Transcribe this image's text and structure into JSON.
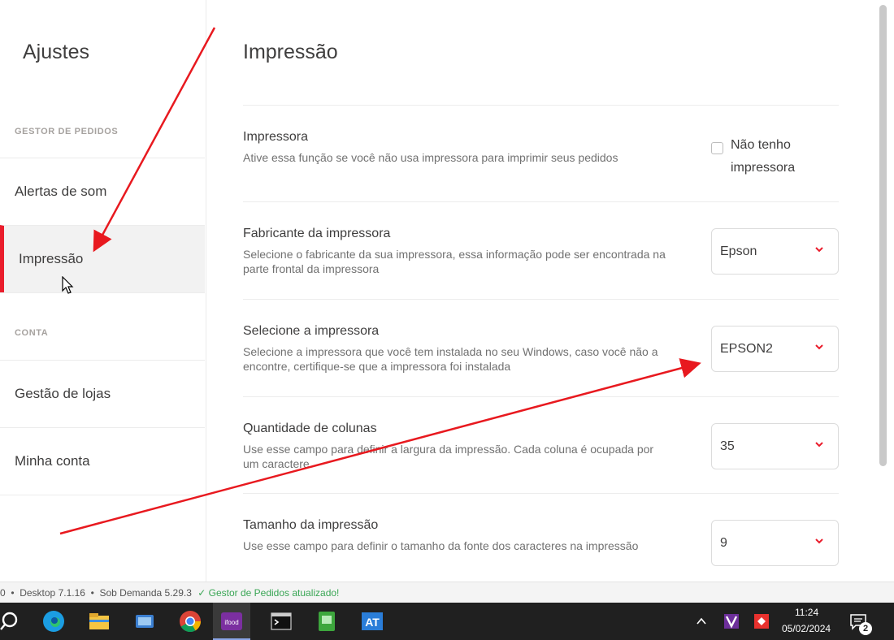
{
  "sidebar": {
    "title": "Ajustes",
    "sections": [
      {
        "label": "GESTOR DE PEDIDOS"
      },
      {
        "label": "CONTA"
      }
    ],
    "items": [
      {
        "label": "Alertas de som"
      },
      {
        "label": "Impressão"
      },
      {
        "label": "Gestão de lojas"
      },
      {
        "label": "Minha conta"
      }
    ]
  },
  "main": {
    "title": "Impressão",
    "rows": [
      {
        "title": "Impressora",
        "desc": "Ative essa função se você não usa impressora para imprimir seus pedidos",
        "checkbox_label": "Não tenho impressora",
        "checked": false
      },
      {
        "title": "Fabricante da impressora",
        "desc": "Selecione o fabricante da sua impressora, essa informação pode ser encontrada na parte frontal da impressora",
        "value": "Epson"
      },
      {
        "title": "Selecione a impressora",
        "desc": "Selecione a impressora que você tem instalada no seu Windows, caso você não a encontre, certifique-se que a impressora foi instalada",
        "value": "EPSON2"
      },
      {
        "title": "Quantidade de colunas",
        "desc": "Use esse campo para definir a largura da impressão. Cada coluna é ocupada por um caractere",
        "value": "35"
      },
      {
        "title": "Tamanho da impressão",
        "desc": "Use esse campo para definir o tamanho da fonte dos caracteres na impressão",
        "value": "9"
      }
    ]
  },
  "statusbar": {
    "text": "0  •  Desktop 7.1.16  •  Sob Demanda 5.29.3 ",
    "ok_text": "✓ Gestor de Pedidos atualizado!"
  },
  "taskbar": {
    "time": "11:24",
    "date": "05/02/2024",
    "notification_count": "2",
    "apps": [
      "search-icon",
      "edge-icon",
      "file-explorer-icon",
      "app-window-icon",
      "chrome-icon",
      "ifood-icon",
      "terminal-icon",
      "green-app-icon",
      "at-app-icon"
    ]
  },
  "colors": {
    "accent": "#ea1d2c",
    "annotation_arrow": "#e8191f"
  }
}
